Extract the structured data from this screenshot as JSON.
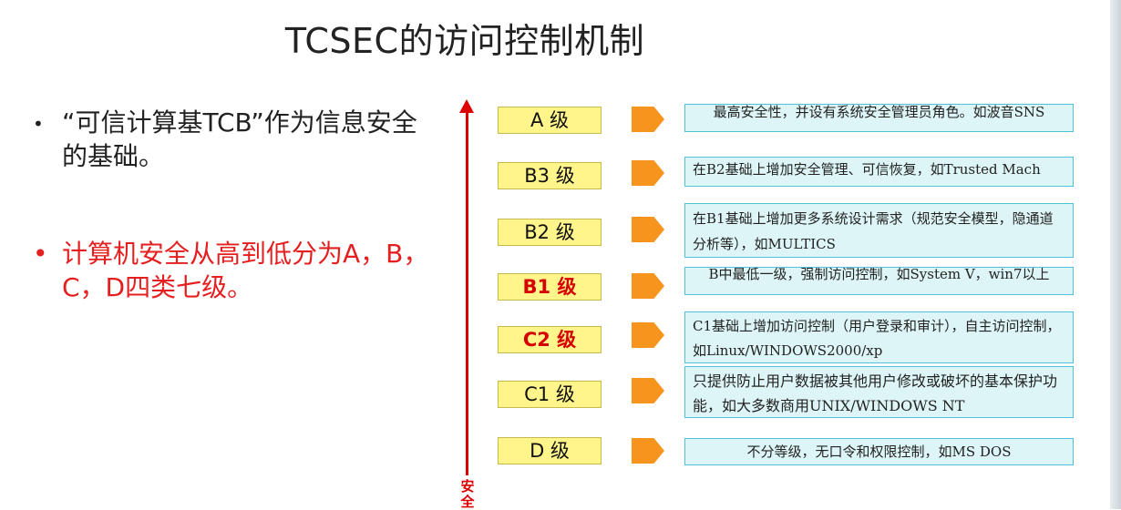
{
  "title": "TCSEC的访问控制机制",
  "bullets": [
    {
      "marker": "•",
      "text": "“可信计算基TCB”作为信息安全的基础。"
    },
    {
      "marker": "•",
      "text": "计算机安全从高到低分为A，B，C，D四类七级。"
    }
  ],
  "axis_label": "安全",
  "levels": [
    {
      "label": "A 级",
      "desc": "最高安全性，并设有系统安全管理员角色。如波音SNS"
    },
    {
      "label": "B3 级",
      "desc": "在B2基础上增加安全管理、可信恢复，如Trusted Mach"
    },
    {
      "label": "B2 级",
      "desc": "在B1基础上增加更多系统设计需求（规范安全模型，隐通道分析等），如MULTICS"
    },
    {
      "label": "B1 级",
      "desc": "B中最低一级，强制访问控制，如System V，win7以上"
    },
    {
      "label": "C2 级",
      "desc": "C1基础上增加访问控制（用户登录和审计），自主访问控制，如Linux/WINDOWS2000/xp"
    },
    {
      "label": "C1 级",
      "desc": "只提供防止用户数据被其他用户修改或破坏的基本保护功能，如大多数商用UNIX/WINDOWS NT"
    },
    {
      "label": "D 级",
      "desc": "不分等级，无口令和权限控制，如MS DOS"
    }
  ],
  "colors": {
    "level_fill": "#fff58a",
    "arrow_shape": "#f7941d",
    "desc_fill": "#ddf5f7",
    "desc_border": "#4fc3d6",
    "emphasis_red": "#d60000"
  }
}
